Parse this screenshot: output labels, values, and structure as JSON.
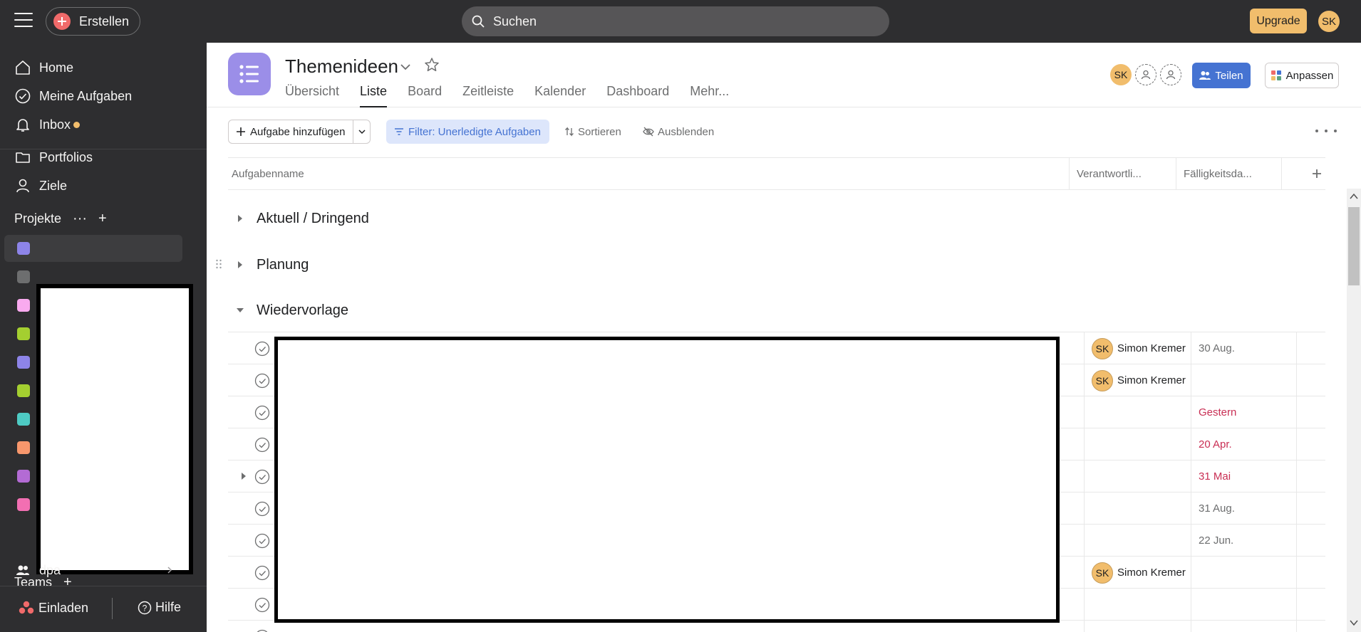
{
  "topbar": {
    "create_label": "Erstellen",
    "search_placeholder": "Suchen",
    "upgrade_label": "Upgrade",
    "user_initials": "SK"
  },
  "sidebar": {
    "nav": [
      {
        "label": "Home",
        "icon": "home-icon"
      },
      {
        "label": "Meine Aufgaben",
        "icon": "check-circle-icon"
      },
      {
        "label": "Inbox",
        "icon": "bell-icon"
      },
      {
        "label": "Portfolios",
        "icon": "folder-icon"
      },
      {
        "label": "Ziele",
        "icon": "person-icon"
      }
    ],
    "projects_label": "Projekte",
    "project_colors": [
      "#8d84e8",
      "#6d6e6f",
      "#f9aaef",
      "#a4cf30",
      "#8d84e8",
      "#a4cf30",
      "#4ecbc4",
      "#f8976c",
      "#b36bd4",
      "#f26fb2"
    ],
    "teams_label": "Teams",
    "team_name": "dpa",
    "invite_label": "Einladen",
    "help_label": "Hilfe"
  },
  "project": {
    "title": "Themenideen",
    "tabs": [
      "Übersicht",
      "Liste",
      "Board",
      "Zeitleiste",
      "Kalender",
      "Dashboard",
      "Mehr..."
    ],
    "active_tab": 1,
    "member_initials": "SK",
    "share_label": "Teilen",
    "customize_label": "Anpassen"
  },
  "toolbar": {
    "add_task_label": "Aufgabe hinzufügen",
    "filter_label": "Filter: Unerledigte Aufgaben",
    "sort_label": "Sortieren",
    "hide_label": "Ausblenden"
  },
  "columns": {
    "name": "Aufgabenname",
    "assignee": "Verantwortli...",
    "due": "Fälligkeitsda..."
  },
  "sections": [
    "Aktuell / Dringend",
    "Planung",
    "Wiedervorlage"
  ],
  "tasks": [
    {
      "assignee_initials": "SK",
      "assignee": "Simon Kremer",
      "due": "30 Aug.",
      "overdue": false
    },
    {
      "assignee_initials": "SK",
      "assignee": "Simon Kremer",
      "due": "",
      "overdue": false
    },
    {
      "assignee_initials": "",
      "assignee": "",
      "due": "Gestern",
      "overdue": true
    },
    {
      "assignee_initials": "",
      "assignee": "",
      "due": "20 Apr.",
      "overdue": true
    },
    {
      "assignee_initials": "",
      "assignee": "",
      "due": "31 Mai",
      "overdue": true,
      "has_subtasks": true
    },
    {
      "assignee_initials": "",
      "assignee": "",
      "due": "31 Aug.",
      "overdue": false
    },
    {
      "assignee_initials": "",
      "assignee": "",
      "due": "22 Jun.",
      "overdue": false
    },
    {
      "assignee_initials": "SK",
      "assignee": "Simon Kremer",
      "due": "",
      "overdue": false
    },
    {
      "assignee_initials": "",
      "assignee": "",
      "due": "",
      "overdue": false
    }
  ],
  "colors": {
    "accent": "#4573d2",
    "overdue": "#c92f54",
    "avatar": "#f1bd6c",
    "project_icon": "#9b8ee8"
  }
}
